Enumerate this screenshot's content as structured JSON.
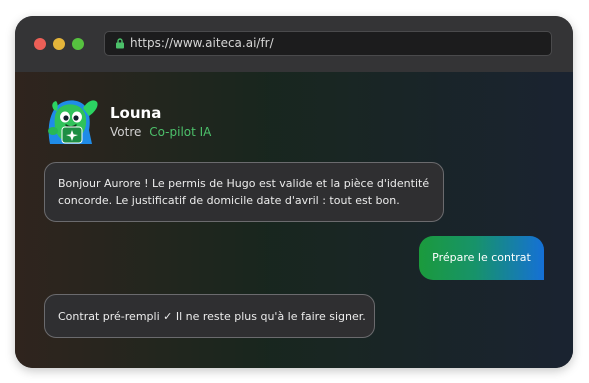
{
  "browser": {
    "url": "https://www.aiteca.ai/fr/",
    "lock_icon": "lock-icon"
  },
  "agent": {
    "name": "Louna",
    "subtitle_prefix": "Votre",
    "subtitle_accent": "Co-pilot IA",
    "avatar_icon": "green-monster-mascot-icon"
  },
  "messages": [
    {
      "from": "agent",
      "text": "Bonjour Aurore ! Le permis de Hugo est valide et la pièce d'identité concorde. Le justificatif de domicile date d'avril : tout est bon."
    },
    {
      "from": "user",
      "text": "Prépare le contrat"
    },
    {
      "from": "agent",
      "text": "Contrat pré-rempli ✓ Il ne reste plus qu'à le faire signer."
    }
  ],
  "colors": {
    "accent_green": "#4cc06a",
    "user_bubble_start": "#1b9a3c",
    "user_bubble_end": "#1570d6",
    "traffic_red": "#ec5f57",
    "traffic_yellow": "#e5b53a",
    "traffic_green": "#56c13f"
  }
}
